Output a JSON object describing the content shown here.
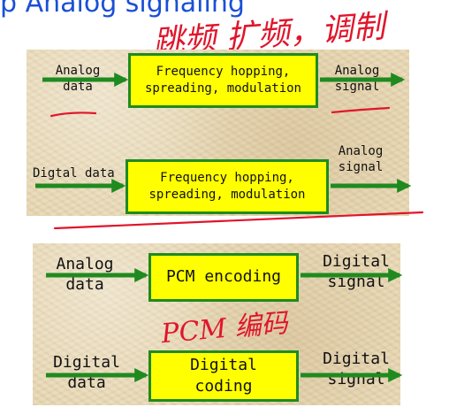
{
  "title": "p Analog signaling",
  "colors": {
    "title": "#1a4fd6",
    "box_fill": "#ffff00",
    "box_border": "#1f8a1f",
    "arrow": "#1f8a1f",
    "annotation": "#e0152b",
    "panel": "#e7d7b3"
  },
  "top_panel": {
    "row1": {
      "input": [
        "Analog",
        "data"
      ],
      "box": [
        "Frequency hopping,",
        "spreading, modulation"
      ],
      "output": [
        "Analog",
        "signal"
      ]
    },
    "row2": {
      "input": [
        "Digtal data"
      ],
      "box": [
        "Frequency hopping,",
        "spreading, modulation"
      ],
      "output": [
        "Analog",
        "signal"
      ]
    }
  },
  "bottom_panel": {
    "row1": {
      "input": [
        "Analog",
        "data"
      ],
      "box": [
        "PCM encoding"
      ],
      "output": [
        "Digital",
        "signal"
      ]
    },
    "row2": {
      "input": [
        "Digital",
        "data"
      ],
      "box": [
        "Digital",
        "coding"
      ],
      "output": [
        "Digital",
        "signal"
      ]
    }
  },
  "annotations": {
    "top": "跳频 扩频，调制",
    "middle": "PCM 编码"
  },
  "icons": {
    "arrow": "arrow-right-icon",
    "underline": "handwritten-underline"
  }
}
